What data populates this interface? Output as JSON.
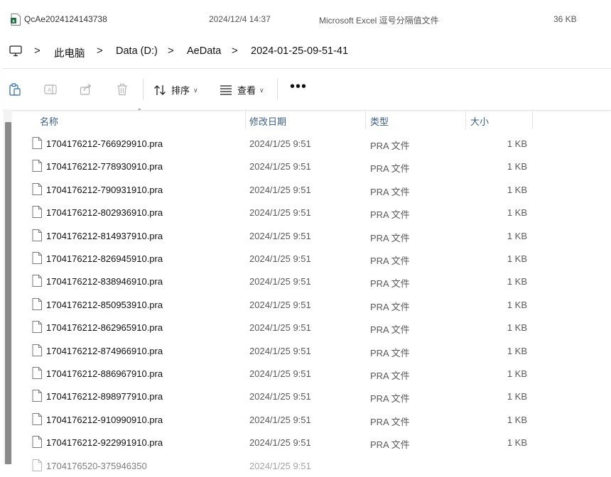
{
  "top_item": {
    "name": "QcAe2024124143738",
    "date": "2024/12/4 14:37",
    "type": "Microsoft Excel 逗号分隔值文件",
    "size": "36 KB",
    "icon": "excel-csv-icon"
  },
  "breadcrumb": {
    "icon": "this-pc-icon",
    "separator": ">",
    "segments": [
      "此电脑",
      "Data (D:)",
      "AeData",
      "2024-01-25-09-51-41"
    ]
  },
  "toolbar": {
    "icons": [
      "paste-icon",
      "rename-icon",
      "share-icon",
      "delete-icon"
    ],
    "sort_label": "排序",
    "view_label": "查看",
    "more_label": "•••"
  },
  "columns": {
    "name": "名称",
    "date": "修改日期",
    "type": "类型",
    "size": "大小"
  },
  "files": [
    {
      "name": "1704176212-766929910.pra",
      "date": "2024/1/25 9:51",
      "type": "PRA 文件",
      "size": "1 KB"
    },
    {
      "name": "1704176212-778930910.pra",
      "date": "2024/1/25 9:51",
      "type": "PRA 文件",
      "size": "1 KB"
    },
    {
      "name": "1704176212-790931910.pra",
      "date": "2024/1/25 9:51",
      "type": "PRA 文件",
      "size": "1 KB"
    },
    {
      "name": "1704176212-802936910.pra",
      "date": "2024/1/25 9:51",
      "type": "PRA 文件",
      "size": "1 KB"
    },
    {
      "name": "1704176212-814937910.pra",
      "date": "2024/1/25 9:51",
      "type": "PRA 文件",
      "size": "1 KB"
    },
    {
      "name": "1704176212-826945910.pra",
      "date": "2024/1/25 9:51",
      "type": "PRA 文件",
      "size": "1 KB"
    },
    {
      "name": "1704176212-838946910.pra",
      "date": "2024/1/25 9:51",
      "type": "PRA 文件",
      "size": "1 KB"
    },
    {
      "name": "1704176212-850953910.pra",
      "date": "2024/1/25 9:51",
      "type": "PRA 文件",
      "size": "1 KB"
    },
    {
      "name": "1704176212-862965910.pra",
      "date": "2024/1/25 9:51",
      "type": "PRA 文件",
      "size": "1 KB"
    },
    {
      "name": "1704176212-874966910.pra",
      "date": "2024/1/25 9:51",
      "type": "PRA 文件",
      "size": "1 KB"
    },
    {
      "name": "1704176212-886967910.pra",
      "date": "2024/1/25 9:51",
      "type": "PRA 文件",
      "size": "1 KB"
    },
    {
      "name": "1704176212-898977910.pra",
      "date": "2024/1/25 9:51",
      "type": "PRA 文件",
      "size": "1 KB"
    },
    {
      "name": "1704176212-910990910.pra",
      "date": "2024/1/25 9:51",
      "type": "PRA 文件",
      "size": "1 KB"
    },
    {
      "name": "1704176212-922991910.pra",
      "date": "2024/1/25 9:51",
      "type": "PRA 文件",
      "size": "1 KB"
    },
    {
      "name": "1704176520-375946350",
      "date": "2024/1/25 9:51",
      "type": "",
      "size": ""
    }
  ],
  "colors": {
    "header_text": "#3b5e8c",
    "scroll_thumb": "#8a8a8a",
    "excel_green": "#1e7145"
  }
}
